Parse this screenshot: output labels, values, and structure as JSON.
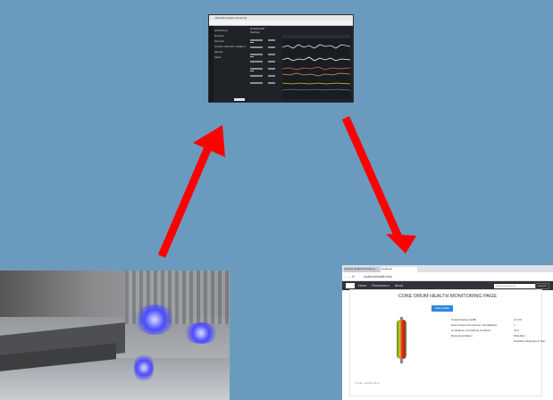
{
  "diagram": {
    "arrow_color": "#ff0000",
    "background_color": "#6a9bbf"
  },
  "top_screenshot": {
    "window_title": "Lab/Cells health monitoring",
    "left_items": [
      "All Devices",
      "Devices",
      "Sensors",
      "Lyndon Cell 123 • Model 1",
      "Sensor",
      "Alerts"
    ],
    "mid_heading": "Dashboards",
    "mid_sub": "Settings",
    "button_label": ""
  },
  "bottom_right_screenshot": {
    "tabs": [
      "Cooling Health Monitoring",
      "localhost"
    ],
    "url": "localhost/health.html",
    "nav_links": [
      "Home",
      "Resources ▾",
      "About"
    ],
    "search_placeholder": "Search Keyword",
    "search_button": "Search",
    "page_title": "COKE DRUM HEALTH MONITORING PAGE",
    "action_button": "View Health Trends",
    "info_rows": [
      {
        "label": "Overall Issues (w/48)",
        "value": "3 of 16",
        "alert": false
      },
      {
        "label": "Open Issues Occurrence Inst (Wdays)",
        "value": "1",
        "alert": true
      },
      {
        "label": "Confidence of Cracking Condition",
        "value": "39%",
        "alert": true
      },
      {
        "label": "Recommendation",
        "value": "Schedule",
        "alert": false
      },
      {
        "label": "",
        "value": "Possible Inspection & Test",
        "alert": false
      }
    ],
    "footer": "© 2nd - 1st/Set 2017"
  }
}
